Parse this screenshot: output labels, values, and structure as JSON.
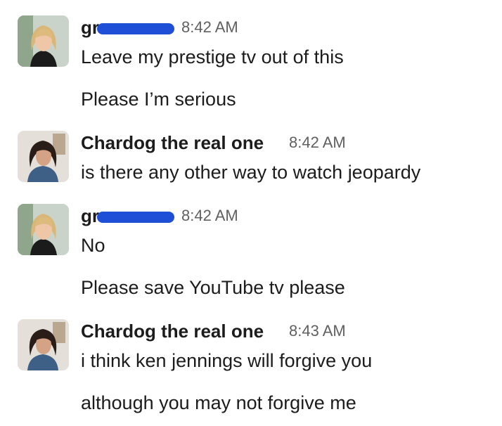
{
  "messages": [
    {
      "author": "gr",
      "author_redacted": true,
      "avatar": "avatar-blonde-woman",
      "time": "8:42 AM",
      "lines": [
        "Leave my prestige tv out of this",
        "Please I’m serious"
      ]
    },
    {
      "author": "Chardog the real one",
      "author_redacted": false,
      "avatar": "avatar-dark-haired-woman",
      "time": "8:42 AM",
      "lines": [
        "is there any other way to watch jeopardy"
      ]
    },
    {
      "author": "gr",
      "author_redacted": true,
      "avatar": "avatar-blonde-woman",
      "time": "8:42 AM",
      "lines": [
        "No",
        "Please save YouTube tv please"
      ]
    },
    {
      "author": "Chardog the real one",
      "author_redacted": false,
      "avatar": "avatar-dark-haired-woman",
      "time": "8:43 AM",
      "lines": [
        "i think ken jennings will forgive you",
        "although you may not forgive me"
      ]
    }
  ],
  "colors": {
    "redaction": "#1f4fd6",
    "timestamp": "#616061",
    "text": "#1d1c1d"
  }
}
